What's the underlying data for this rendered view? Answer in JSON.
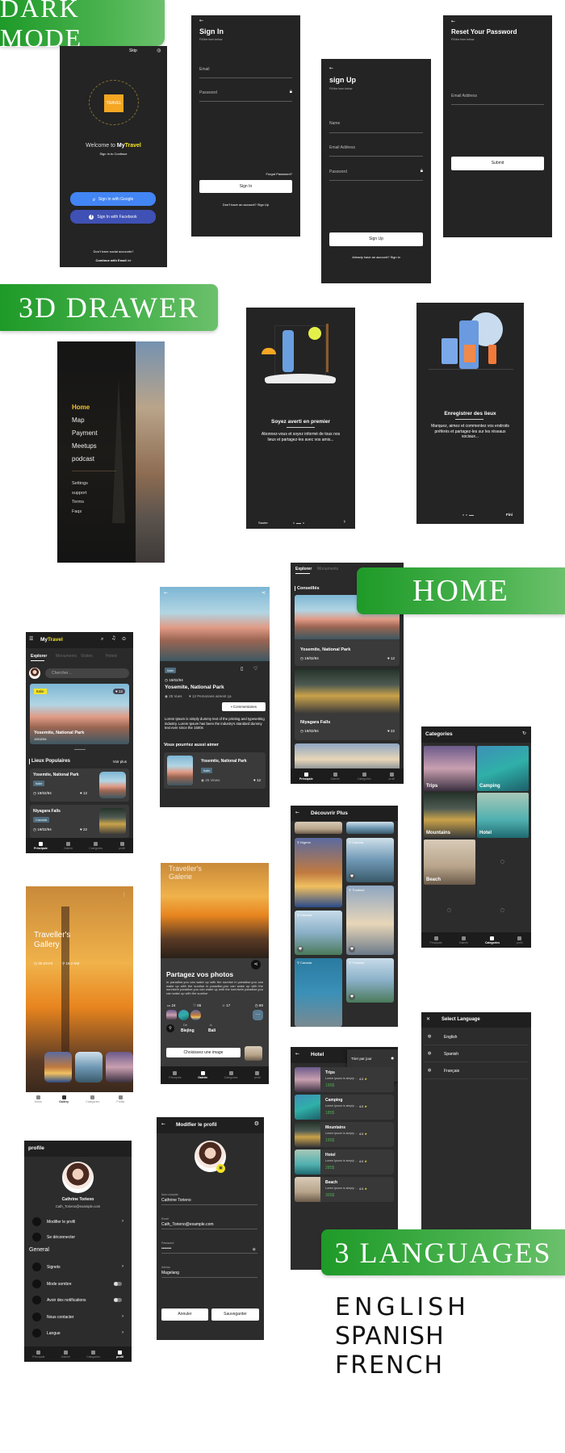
{
  "colors": {
    "accent_green": "#2e9e35",
    "brand_yellow": "#f5e426",
    "google_blue": "#4285f4",
    "facebook_blue": "#3f51b5",
    "price_green": "#4caf50",
    "screen_bg": "#242424"
  },
  "banners": {
    "dark_mode": "DARK MODE",
    "drawer": "3D DRAWER",
    "home": "HOME",
    "languages": "3 LANGUAGES"
  },
  "languages_list": [
    "ENGLISH",
    "SPANISH",
    "FRENCH"
  ],
  "welcome": {
    "skip": "Skip",
    "welcome_prefix": "Welcome to",
    "brand_my": "My",
    "brand_travel": "Travel",
    "subtitle": "Sign In to Continue",
    "logo_text": "TRAVEL",
    "google_btn": "Sign In with Google",
    "facebook_btn": "Sign In with Facebook",
    "no_social": "Don't have social accounts?",
    "continue_email": "Continue with Email >>",
    "icons": {
      "skip_globe": "globe-icon",
      "google": "google-icon",
      "facebook": "facebook-icon"
    }
  },
  "sign_in": {
    "title": "Sign In",
    "subtitle": "Fill the form below",
    "email_label": "Email",
    "password_label": "Password",
    "forgot": "Forgot Password?",
    "button": "Sign In",
    "no_account": "Don't have an account?",
    "sign_up_link": "Sign Up"
  },
  "sign_up": {
    "title": "sign Up",
    "subtitle": "Fill the form below",
    "name_label": "Name",
    "email_label": "Email Address",
    "password_label": "Password",
    "button": "Sign Up",
    "have_account": "Already have an account?",
    "sign_in_link": "Sign in"
  },
  "reset": {
    "title": "Reset Your Password",
    "subtitle": "Fill the form below",
    "email_label": "Email Address",
    "button": "Submit"
  },
  "drawer": {
    "main_items": [
      "Home",
      "Map",
      "Payment",
      "Meetups",
      "podcast"
    ],
    "active": "Home",
    "minor_items": [
      "Settings",
      "support",
      "Terms",
      "Faqs"
    ]
  },
  "onboarding_1": {
    "title": "Soyez averti en premier",
    "text": "Abonnez-vous et soyez informé de tous nos lieux et partagez-les avec vos amis...",
    "skip": "Sauter",
    "next": "›",
    "page": 2,
    "pages": 3
  },
  "onboarding_2": {
    "title": "Enregistrer des lieux",
    "text": "Marquez, aimez et commentez vos endroits préférés et partagez-les sur les réseaux sociaux...",
    "finish": "Fini",
    "page": 3,
    "pages": 3
  },
  "nav_main": [
    "Principale",
    "Galerie",
    "Categories",
    "profil"
  ],
  "nav_gallery": [
    "Home",
    "Gallery",
    "Categories",
    "Profile"
  ],
  "home": {
    "brand_my": "My",
    "brand_travel": "Travel",
    "tabs": [
      "Explorer",
      "Monuments",
      "Visites",
      "Hotels"
    ],
    "search_placeholder": "Chercher ..",
    "featured": {
      "badge": "Italie",
      "likes": "12",
      "title": "Yosemite, National Park",
      "date": "19/02/94"
    },
    "section": "Lieux Populaires",
    "see_more": "Voir plus",
    "cards": [
      {
        "title": "Yosemite, National Park",
        "badge": "Italie",
        "date": "19/02/94",
        "likes": "12"
      },
      {
        "title": "Niyagara Falls",
        "badge": "Canada",
        "date": "19/02/94",
        "likes": "22"
      }
    ]
  },
  "detail": {
    "badge": "Italie",
    "date": "19/02/94",
    "title": "Yosemite, National Park",
    "views": "25 Vues",
    "likes": "12",
    "likes_text": "Personnes aiment ça",
    "comments_btn": "Commentaires",
    "body": "Lorem Ipsum is simply dummy text of the printing and typesetting industry. Lorem Ipsum has been the industry's standard dummy text ever since the 1500s",
    "related_title": "Vous pourriez aussi aimer",
    "related": {
      "title": "Yosemite, National Park",
      "badge": "Italie",
      "views": "25 Views",
      "likes": "12"
    }
  },
  "conseilles": {
    "tabs": [
      "Explorer",
      "Monuments"
    ],
    "section": "Conseillés",
    "cards": [
      {
        "title": "Yosemite, National Park",
        "date": "19/02/94",
        "likes": "12"
      },
      {
        "title": "Niyagara Falls",
        "date": "19/02/94",
        "likes": "22"
      }
    ]
  },
  "categories": {
    "title": "Categories",
    "items": [
      "Trips",
      "Camping",
      "Mountains",
      "Hotel",
      "Beach"
    ]
  },
  "discover": {
    "title": "Découvrir Plus",
    "tiles": [
      "Nigeria",
      "Canada",
      "Canada",
      "Thailand",
      "Canada",
      "Thailand"
    ]
  },
  "gallery": {
    "title": "Traveller's Gallery",
    "days": "30 DAYS",
    "distance": "18.2 KM"
  },
  "share": {
    "bg_title": "Traveller's Galerie",
    "title": "Partagez vos photos",
    "text": "In paradise,you can wake up with the sunrise in paradise,you can wake up with the sunrise in paradise,you can wake up with the sunrisein paradise,you can wake up with the sunrisein paradise,you can wake up with the sunrise",
    "stats": {
      "comments": "24",
      "likes": "65",
      "stars": "17",
      "views": "80"
    },
    "from_label": "De",
    "from": "Biejing",
    "to_label": "A",
    "to": "Bali",
    "choose_btn": "Choisissez une image"
  },
  "hotel": {
    "title": "Hotel",
    "sort_options": [
      "Trier par jour",
      "Trier par prix"
    ],
    "items": [
      {
        "name": "Trips",
        "desc": "Lorem Ipsum is simply ...",
        "rating": "4.0",
        "price": "195$"
      },
      {
        "name": "Camping",
        "desc": "Lorem Ipsum is simply ...",
        "rating": "4.0",
        "price": "185$"
      },
      {
        "name": "Mountains",
        "desc": "Lorem Ipsum is simply ...",
        "rating": "4.0",
        "price": "195$"
      },
      {
        "name": "Hotel",
        "desc": "Lorem Ipsum is simply ...",
        "rating": "4.0",
        "price": "285$"
      },
      {
        "name": "Beach",
        "desc": "Lorem Ipsum is simply ...",
        "rating": "4.0",
        "price": "305$"
      }
    ]
  },
  "language": {
    "title": "Select Language",
    "options": [
      "English",
      "Spanish",
      "Français"
    ]
  },
  "profile": {
    "title": "profile",
    "name": "Cathrine Torieno",
    "email": "Cath_Torieno@example.com",
    "top_items": [
      {
        "label": "Modifier le profil",
        "arrow": "›"
      },
      {
        "label": "Se déconnecter",
        "arrow": ""
      }
    ],
    "general": "General",
    "general_items": [
      {
        "label": "Signets",
        "type": "arrow"
      },
      {
        "label": "Mode sombre",
        "type": "toggle",
        "on": false
      },
      {
        "label": "Avoir des notifications",
        "type": "toggle",
        "on": false
      },
      {
        "label": "Nous contacter",
        "type": "arrow"
      },
      {
        "label": "Langue",
        "type": "arrow"
      }
    ]
  },
  "edit_profile": {
    "title": "Modifier le profil",
    "fields": [
      {
        "label": "Nom complet",
        "value": "Cathrine Torieno"
      },
      {
        "label": "Email",
        "value": "Cath_Torieno@example.com"
      },
      {
        "label": "Password",
        "value": "•••••••"
      },
      {
        "label": "Adress",
        "value": "Magelang"
      }
    ],
    "cancel": "Annuler",
    "save": "Sauvegarder"
  }
}
